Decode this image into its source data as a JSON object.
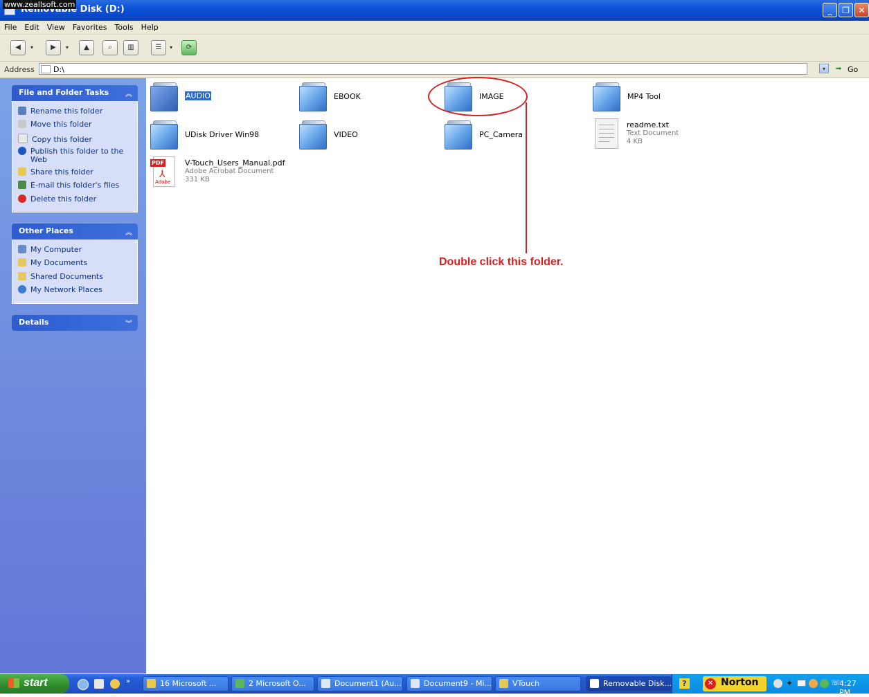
{
  "watermark": "www.zeallsoft.com",
  "window": {
    "title": "Removable Disk (D:)"
  },
  "menu": [
    "File",
    "Edit",
    "View",
    "Favorites",
    "Tools",
    "Help"
  ],
  "address": {
    "label": "Address",
    "value": "D:\\",
    "go": "Go"
  },
  "panels": {
    "file_tasks": {
      "title": "File and Folder Tasks",
      "items": [
        "Rename this folder",
        "Move this folder",
        "Copy this folder",
        "Publish this folder to the",
        "Web",
        "Share this folder",
        "E-mail this folder's files",
        "Delete this folder"
      ]
    },
    "other_places": {
      "title": "Other Places",
      "items": [
        "My Computer",
        "My Documents",
        "Shared Documents",
        "My Network Places"
      ]
    },
    "details": {
      "title": "Details"
    }
  },
  "files": {
    "audio": "AUDIO",
    "ebook": "EBOOK",
    "image": "IMAGE",
    "mp4tool": "MP4 Tool",
    "udisk": "UDisk Driver Win98",
    "video": "VIDEO",
    "pccamera": "PC_Camera",
    "readme": {
      "name": "readme.txt",
      "type": "Text Document",
      "size": "4 KB"
    },
    "manual": {
      "name": "V-Touch_Users_Manual.pdf",
      "type": "Adobe Acrobat Document",
      "size": "331 KB",
      "badge": "PDF",
      "logo": "Adobe"
    }
  },
  "annotation": "Double click this folder.",
  "taskbar": {
    "start": "start",
    "tasks": [
      "16 Microsoft ...",
      "2 Microsoft O...",
      "Document1 (Au...",
      "Document9 - Mi...",
      "VTouch",
      "Removable Disk..."
    ],
    "norton": "Norton",
    "clock": "4:27 PM"
  }
}
